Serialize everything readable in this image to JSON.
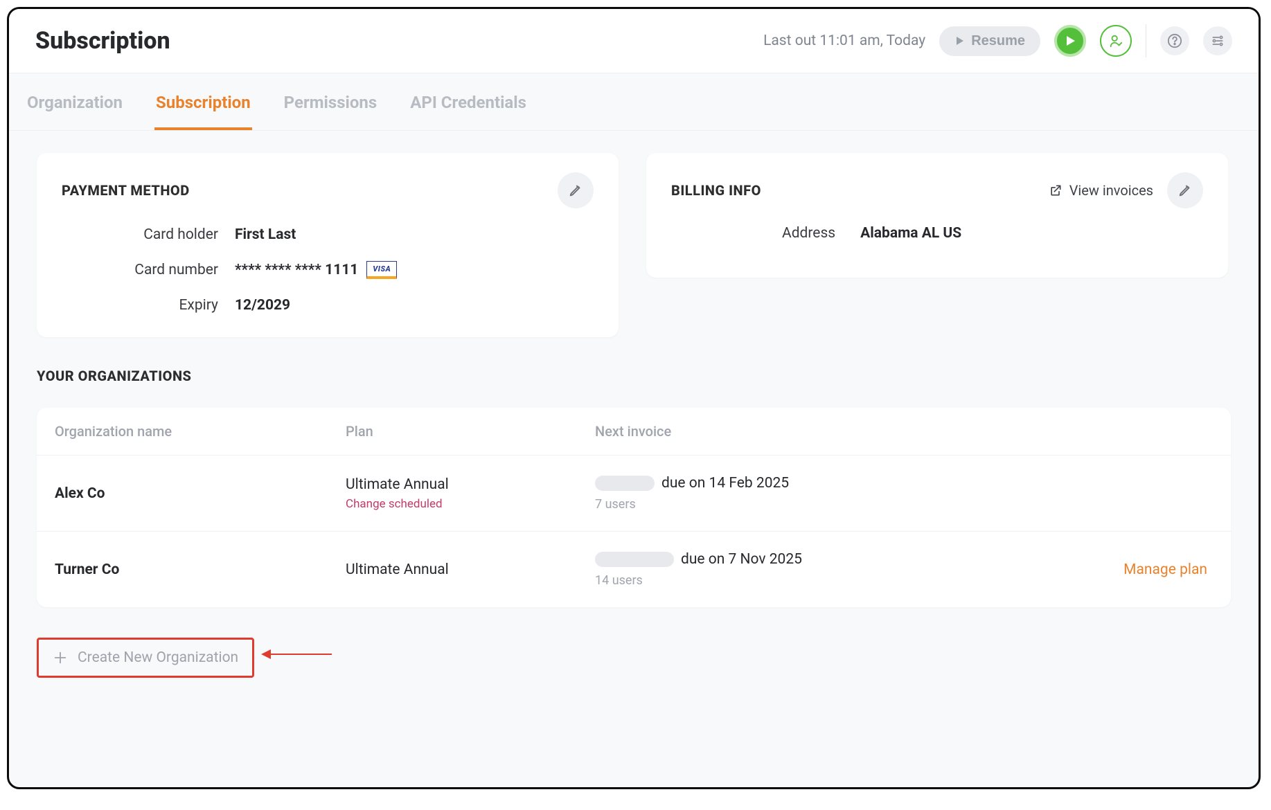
{
  "header": {
    "title": "Subscription",
    "last_out": "Last out 11:01 am, Today",
    "resume_label": "Resume"
  },
  "tabs": [
    {
      "label": "Organization",
      "active": false
    },
    {
      "label": "Subscription",
      "active": true
    },
    {
      "label": "Permissions",
      "active": false
    },
    {
      "label": "API Credentials",
      "active": false
    }
  ],
  "payment": {
    "title": "PAYMENT METHOD",
    "fields": {
      "holder_label": "Card holder",
      "holder_value": "First Last",
      "number_label": "Card number",
      "number_value": "**** **** **** 1111",
      "brand": "VISA",
      "expiry_label": "Expiry",
      "expiry_value": "12/2029"
    }
  },
  "billing": {
    "title": "BILLING INFO",
    "view_invoices": "View invoices",
    "address_label": "Address",
    "address_value": "Alabama AL US"
  },
  "orgs_section": {
    "title": "YOUR ORGANIZATIONS",
    "columns": {
      "name": "Organization name",
      "plan": "Plan",
      "next": "Next invoice"
    },
    "rows": [
      {
        "name": "Alex Co",
        "plan": "Ultimate Annual",
        "plan_note": "Change scheduled",
        "next_suffix": "due on 14 Feb 2025",
        "users": "7 users",
        "manage": ""
      },
      {
        "name": "Turner Co",
        "plan": "Ultimate Annual",
        "plan_note": "",
        "next_suffix": "due on 7 Nov 2025",
        "users": "14 users",
        "manage": "Manage plan"
      }
    ],
    "create_new": "Create New Organization"
  }
}
